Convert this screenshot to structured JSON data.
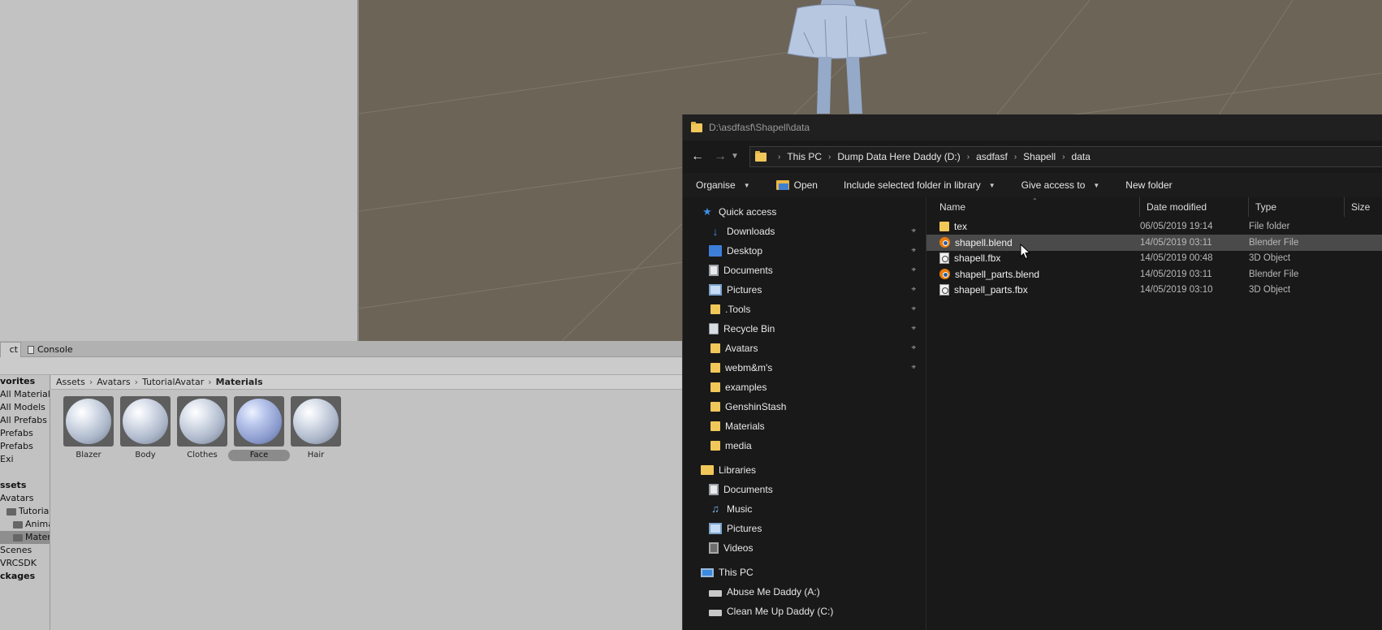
{
  "unity": {
    "tabs": {
      "project": "ct",
      "console": "Console"
    },
    "breadcrumb": [
      "Assets",
      "Avatars",
      "TutorialAvatar",
      "Materials"
    ],
    "tree": [
      {
        "label": "vorites",
        "header": true,
        "indent": 0,
        "selected": false
      },
      {
        "label": "All Materials",
        "header": false,
        "indent": 0,
        "selected": false
      },
      {
        "label": "All Models",
        "header": false,
        "indent": 0,
        "selected": false
      },
      {
        "label": "All Prefabs",
        "header": false,
        "indent": 0,
        "selected": false
      },
      {
        "label": "Prefabs",
        "header": false,
        "indent": 0,
        "selected": false
      },
      {
        "label": "Prefabs",
        "header": false,
        "indent": 0,
        "selected": false
      },
      {
        "label": "Exi",
        "header": false,
        "indent": 0,
        "selected": false
      },
      {
        "label": "",
        "header": false,
        "indent": 0,
        "selected": false
      },
      {
        "label": "ssets",
        "header": true,
        "indent": 0,
        "selected": false
      },
      {
        "label": "Avatars",
        "header": false,
        "indent": 0,
        "selected": false
      },
      {
        "label": "TutorialA",
        "header": false,
        "indent": 1,
        "selected": false,
        "folder": true
      },
      {
        "label": "Animat",
        "header": false,
        "indent": 2,
        "selected": false,
        "folder": true
      },
      {
        "label": "Materi",
        "header": false,
        "indent": 2,
        "selected": true,
        "folder": true
      },
      {
        "label": "Scenes",
        "header": false,
        "indent": 0,
        "selected": false
      },
      {
        "label": "VRCSDK",
        "header": false,
        "indent": 0,
        "selected": false
      },
      {
        "label": "ckages",
        "header": true,
        "indent": 0,
        "selected": false
      }
    ],
    "materials": [
      {
        "label": "Blazer",
        "selected": false
      },
      {
        "label": "Body",
        "selected": false
      },
      {
        "label": "Clothes",
        "selected": false
      },
      {
        "label": "Face",
        "selected": true
      },
      {
        "label": "Hair",
        "selected": false
      }
    ]
  },
  "explorer": {
    "title": "D:\\asdfasf\\Shapell\\data",
    "address": [
      "This PC",
      "Dump Data Here Daddy (D:)",
      "asdfasf",
      "Shapell",
      "data"
    ],
    "toolbar": {
      "organise": "Organise",
      "open": "Open",
      "include": "Include selected folder in library",
      "share": "Give access to",
      "new_folder": "New folder"
    },
    "columns": {
      "name": "Name",
      "date": "Date modified",
      "type": "Type",
      "size": "Size"
    },
    "nav": [
      {
        "label": "Quick access",
        "icon": "star-icon",
        "level": 0,
        "pinned": false,
        "gap": false
      },
      {
        "label": "Downloads",
        "icon": "download-icon",
        "level": 1,
        "pinned": true,
        "gap": false
      },
      {
        "label": "Desktop",
        "icon": "desktop-icon",
        "level": 1,
        "pinned": true,
        "gap": false
      },
      {
        "label": "Documents",
        "icon": "documents-icon",
        "level": 1,
        "pinned": true,
        "gap": false
      },
      {
        "label": "Pictures",
        "icon": "pictures-icon",
        "level": 1,
        "pinned": true,
        "gap": false
      },
      {
        "label": ".Tools",
        "icon": "folder-icon",
        "level": 1,
        "pinned": true,
        "gap": false
      },
      {
        "label": "Recycle Bin",
        "icon": "recycle-bin-icon",
        "level": 1,
        "pinned": true,
        "gap": false
      },
      {
        "label": "Avatars",
        "icon": "folder-icon",
        "level": 1,
        "pinned": true,
        "gap": false
      },
      {
        "label": "webm&m's",
        "icon": "folder-icon",
        "level": 1,
        "pinned": true,
        "gap": false
      },
      {
        "label": "examples",
        "icon": "folder-icon",
        "level": 1,
        "pinned": false,
        "gap": false
      },
      {
        "label": "GenshinStash",
        "icon": "folder-icon",
        "level": 1,
        "pinned": false,
        "gap": false
      },
      {
        "label": "Materials",
        "icon": "folder-icon",
        "level": 1,
        "pinned": false,
        "gap": false
      },
      {
        "label": "media",
        "icon": "folder-icon",
        "level": 1,
        "pinned": false,
        "gap": false
      },
      {
        "label": "Libraries",
        "icon": "libraries-icon",
        "level": 0,
        "pinned": false,
        "gap": true
      },
      {
        "label": "Documents",
        "icon": "documents-icon",
        "level": 1,
        "pinned": false,
        "gap": false
      },
      {
        "label": "Music",
        "icon": "music-icon",
        "level": 1,
        "pinned": false,
        "gap": false
      },
      {
        "label": "Pictures",
        "icon": "pictures-icon",
        "level": 1,
        "pinned": false,
        "gap": false
      },
      {
        "label": "Videos",
        "icon": "videos-icon",
        "level": 1,
        "pinned": false,
        "gap": false
      },
      {
        "label": "This PC",
        "icon": "this-pc-icon",
        "level": 0,
        "pinned": false,
        "gap": true
      },
      {
        "label": "Abuse Me Daddy (A:)",
        "icon": "drive-icon",
        "level": 1,
        "pinned": false,
        "gap": false
      },
      {
        "label": "Clean Me Up Daddy (C:)",
        "icon": "drive-icon",
        "level": 1,
        "pinned": false,
        "gap": false
      }
    ],
    "files": [
      {
        "name": "tex",
        "date": "06/05/2019 19:14",
        "type": "File folder",
        "icon": "folder-icon",
        "hover": false
      },
      {
        "name": "shapell.blend",
        "date": "14/05/2019 03:11",
        "type": "Blender File",
        "icon": "blender-icon",
        "hover": true
      },
      {
        "name": "shapell.fbx",
        "date": "14/05/2019 00:48",
        "type": "3D Object",
        "icon": "3d-object-icon",
        "hover": false
      },
      {
        "name": "shapell_parts.blend",
        "date": "14/05/2019 03:11",
        "type": "Blender File",
        "icon": "blender-icon",
        "hover": false
      },
      {
        "name": "shapell_parts.fbx",
        "date": "14/05/2019 03:10",
        "type": "3D Object",
        "icon": "3d-object-icon",
        "hover": false
      }
    ]
  }
}
